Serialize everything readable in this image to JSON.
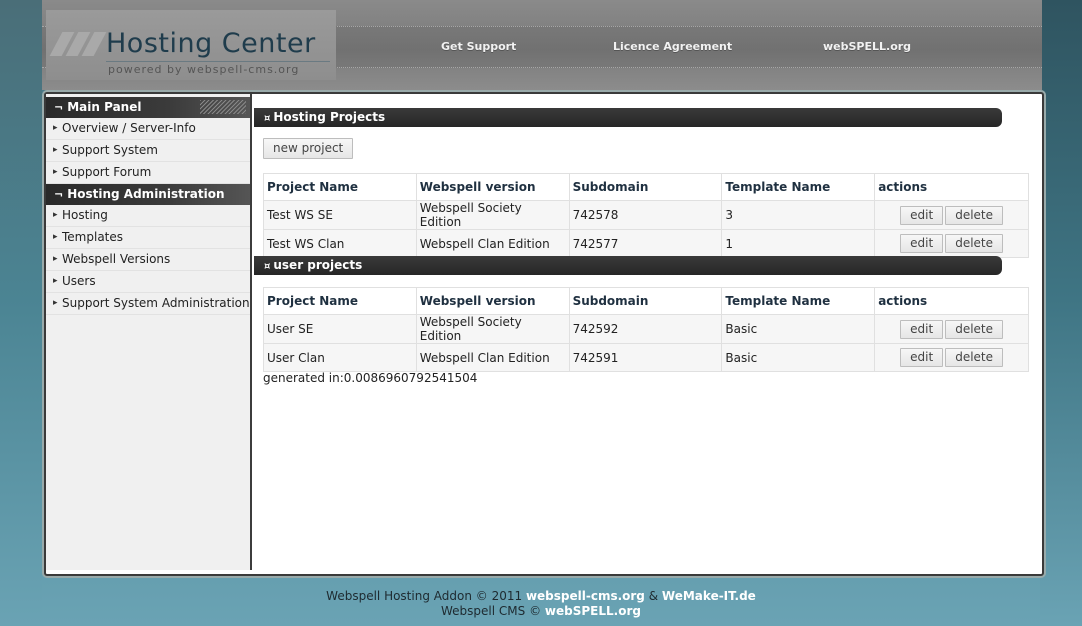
{
  "header": {
    "logo_title": "Hosting Center",
    "logo_subtitle": "powered by webspell-cms.org",
    "nav": [
      "Get Support",
      "Licence Agreement",
      "webSPELL.org"
    ]
  },
  "sidebar": {
    "main_panel": {
      "title": "Main Panel",
      "items": [
        "Overview / Server-Info",
        "Support System",
        "Support Forum"
      ]
    },
    "hosting_admin": {
      "title": "Hosting Administration",
      "items": [
        "Hosting",
        "Templates",
        "Webspell Versions",
        "Users",
        "Support System Administration"
      ]
    }
  },
  "hosting_projects": {
    "title": "Hosting Projects",
    "new_button": "new project",
    "columns": [
      "Project Name",
      "Webspell version",
      "Subdomain",
      "Template Name",
      "actions"
    ],
    "rows": [
      {
        "name": "Test WS SE",
        "version": "Webspell Society Edition",
        "subdomain": "742578",
        "template": "3"
      },
      {
        "name": "Test WS Clan",
        "version": "Webspell Clan Edition",
        "subdomain": "742577",
        "template": "1"
      }
    ]
  },
  "user_projects": {
    "title": "user projects",
    "columns": [
      "Project Name",
      "Webspell version",
      "Subdomain",
      "Template Name",
      "actions"
    ],
    "rows": [
      {
        "name": "User SE",
        "version": "Webspell Society Edition",
        "subdomain": "742592",
        "template": "Basic"
      },
      {
        "name": "User Clan",
        "version": "Webspell Clan Edition",
        "subdomain": "742591",
        "template": "Basic"
      }
    ]
  },
  "actions": {
    "edit": "edit",
    "delete": "delete"
  },
  "generated": "generated in:0.0086960792541504",
  "footer": {
    "line1_prefix": "Webspell Hosting Addon © 2011",
    "line1_link1": "webspell-cms.org",
    "line1_amp": "&",
    "line1_link2": "WeMake-IT.de",
    "line2_prefix": "Webspell CMS ©",
    "line2_link": "webSPELL.org"
  },
  "colors": {
    "sidebar_head": "#2a2a2a",
    "section_bar": "#2e2e2e",
    "footer_link": "#ffffff"
  }
}
